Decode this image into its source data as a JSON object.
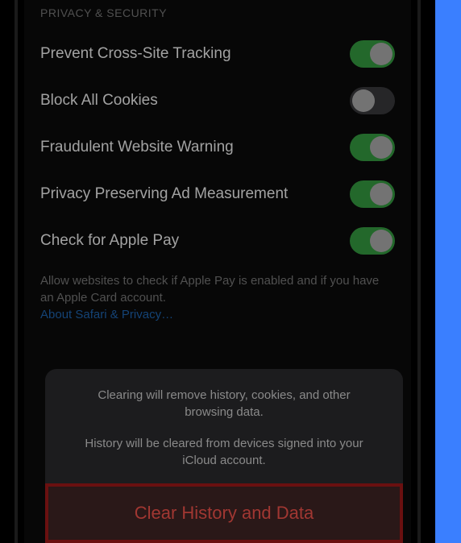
{
  "section": {
    "header": "PRIVACY & SECURITY",
    "items": [
      {
        "label": "Prevent Cross-Site Tracking",
        "on": true
      },
      {
        "label": "Block All Cookies",
        "on": false
      },
      {
        "label": "Fraudulent Website Warning",
        "on": true
      },
      {
        "label": "Privacy Preserving Ad Measurement",
        "on": true
      },
      {
        "label": "Check for Apple Pay",
        "on": true
      }
    ],
    "footer": "Allow websites to check if Apple Pay is enabled and if you have an Apple Card account.",
    "footer_link": "About Safari & Privacy…"
  },
  "sheet": {
    "line1": "Clearing will remove history, cookies, and other browsing data.",
    "line2": "History will be cleared from devices signed into your iCloud account.",
    "action": "Clear History and Data"
  }
}
